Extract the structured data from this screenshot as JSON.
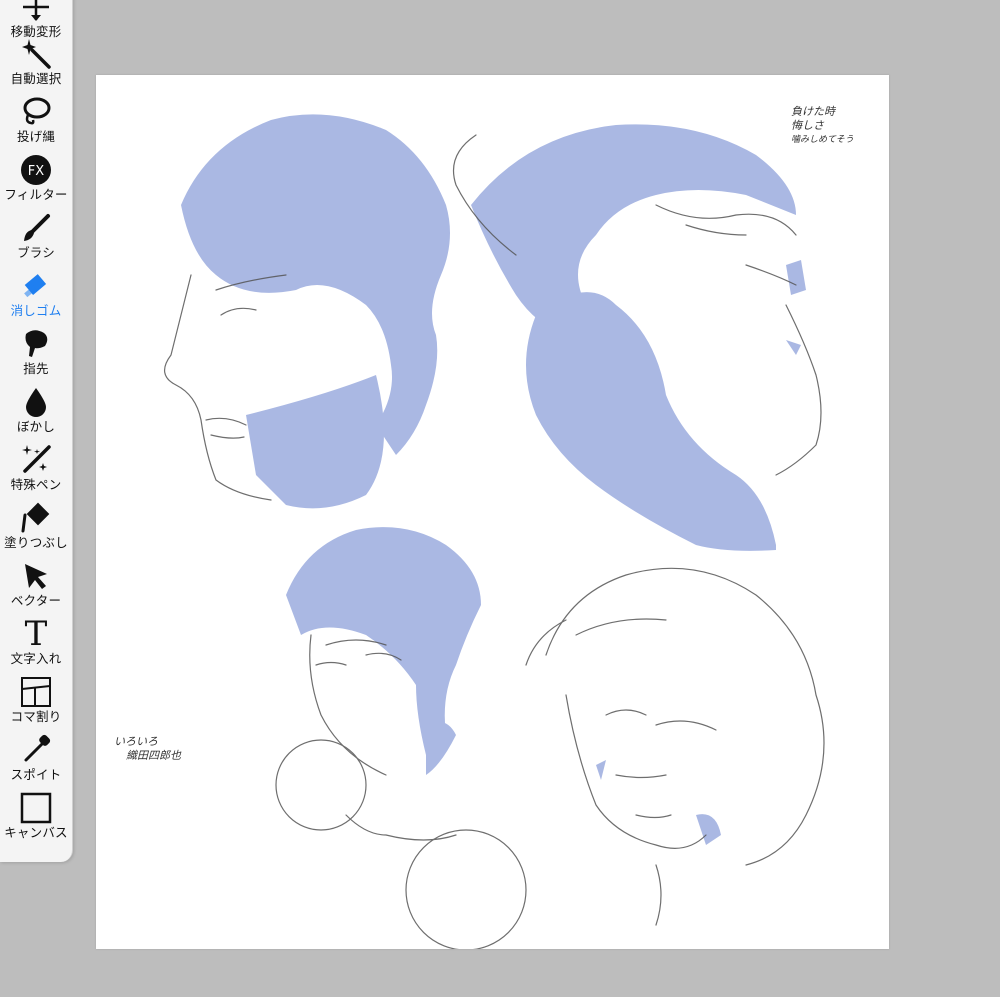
{
  "toolbar": {
    "tools": [
      {
        "label": "移動変形",
        "icon": "move-transform-icon"
      },
      {
        "label": "自動選択",
        "icon": "magic-wand-icon"
      },
      {
        "label": "投げ縄",
        "icon": "lasso-icon"
      },
      {
        "label": "フィルター",
        "icon": "fx-filter-icon"
      },
      {
        "label": "ブラシ",
        "icon": "brush-icon"
      },
      {
        "label": "消しゴム",
        "icon": "eraser-icon"
      },
      {
        "label": "指先",
        "icon": "finger-smudge-icon"
      },
      {
        "label": "ぼかし",
        "icon": "blur-drop-icon"
      },
      {
        "label": "特殊ペン",
        "icon": "special-pen-icon"
      },
      {
        "label": "塗りつぶし",
        "icon": "fill-bucket-icon"
      },
      {
        "label": "ベクター",
        "icon": "vector-arrow-icon"
      },
      {
        "label": "文字入れ",
        "icon": "text-icon"
      },
      {
        "label": "コマ割り",
        "icon": "panel-divide-icon"
      },
      {
        "label": "スポイト",
        "icon": "eyedropper-icon"
      },
      {
        "label": "キャンバス",
        "icon": "canvas-icon"
      }
    ],
    "active_tool": "消しゴム",
    "fx_glyph": "FX",
    "text_glyph": "T",
    "active_color": "#1f7ff0"
  },
  "canvas": {
    "notes": {
      "top_right": [
        "負けた時",
        "悔しさ",
        "噛みしめてそう"
      ],
      "bottom_left": [
        "いろいろ",
        "織田四郎也"
      ]
    },
    "accent_color": "#aab8e3"
  }
}
